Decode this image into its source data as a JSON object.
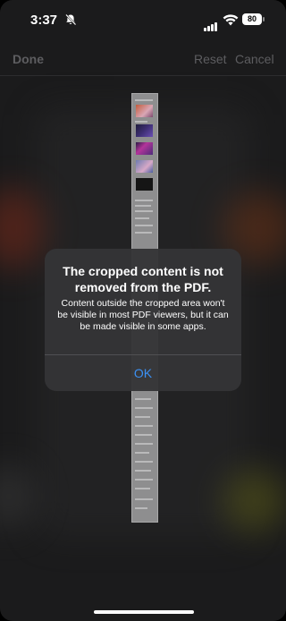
{
  "status_bar": {
    "time": "3:37",
    "battery": "80",
    "icons": [
      "bell-slash-icon",
      "cellular-signal-icon",
      "wifi-icon",
      "battery-icon"
    ]
  },
  "nav": {
    "done_label": "Done",
    "reset_label": "Reset",
    "cancel_label": "Cancel"
  },
  "alert": {
    "title": "The cropped content is not removed from the PDF.",
    "message": "Content outside the cropped area won't be visible in most PDF viewers, but it can be made visible in some apps.",
    "ok_label": "OK"
  },
  "colors": {
    "accent": "#3b91f5",
    "alert_bg": "#343436",
    "nav_disabled": "#5d5d60"
  }
}
